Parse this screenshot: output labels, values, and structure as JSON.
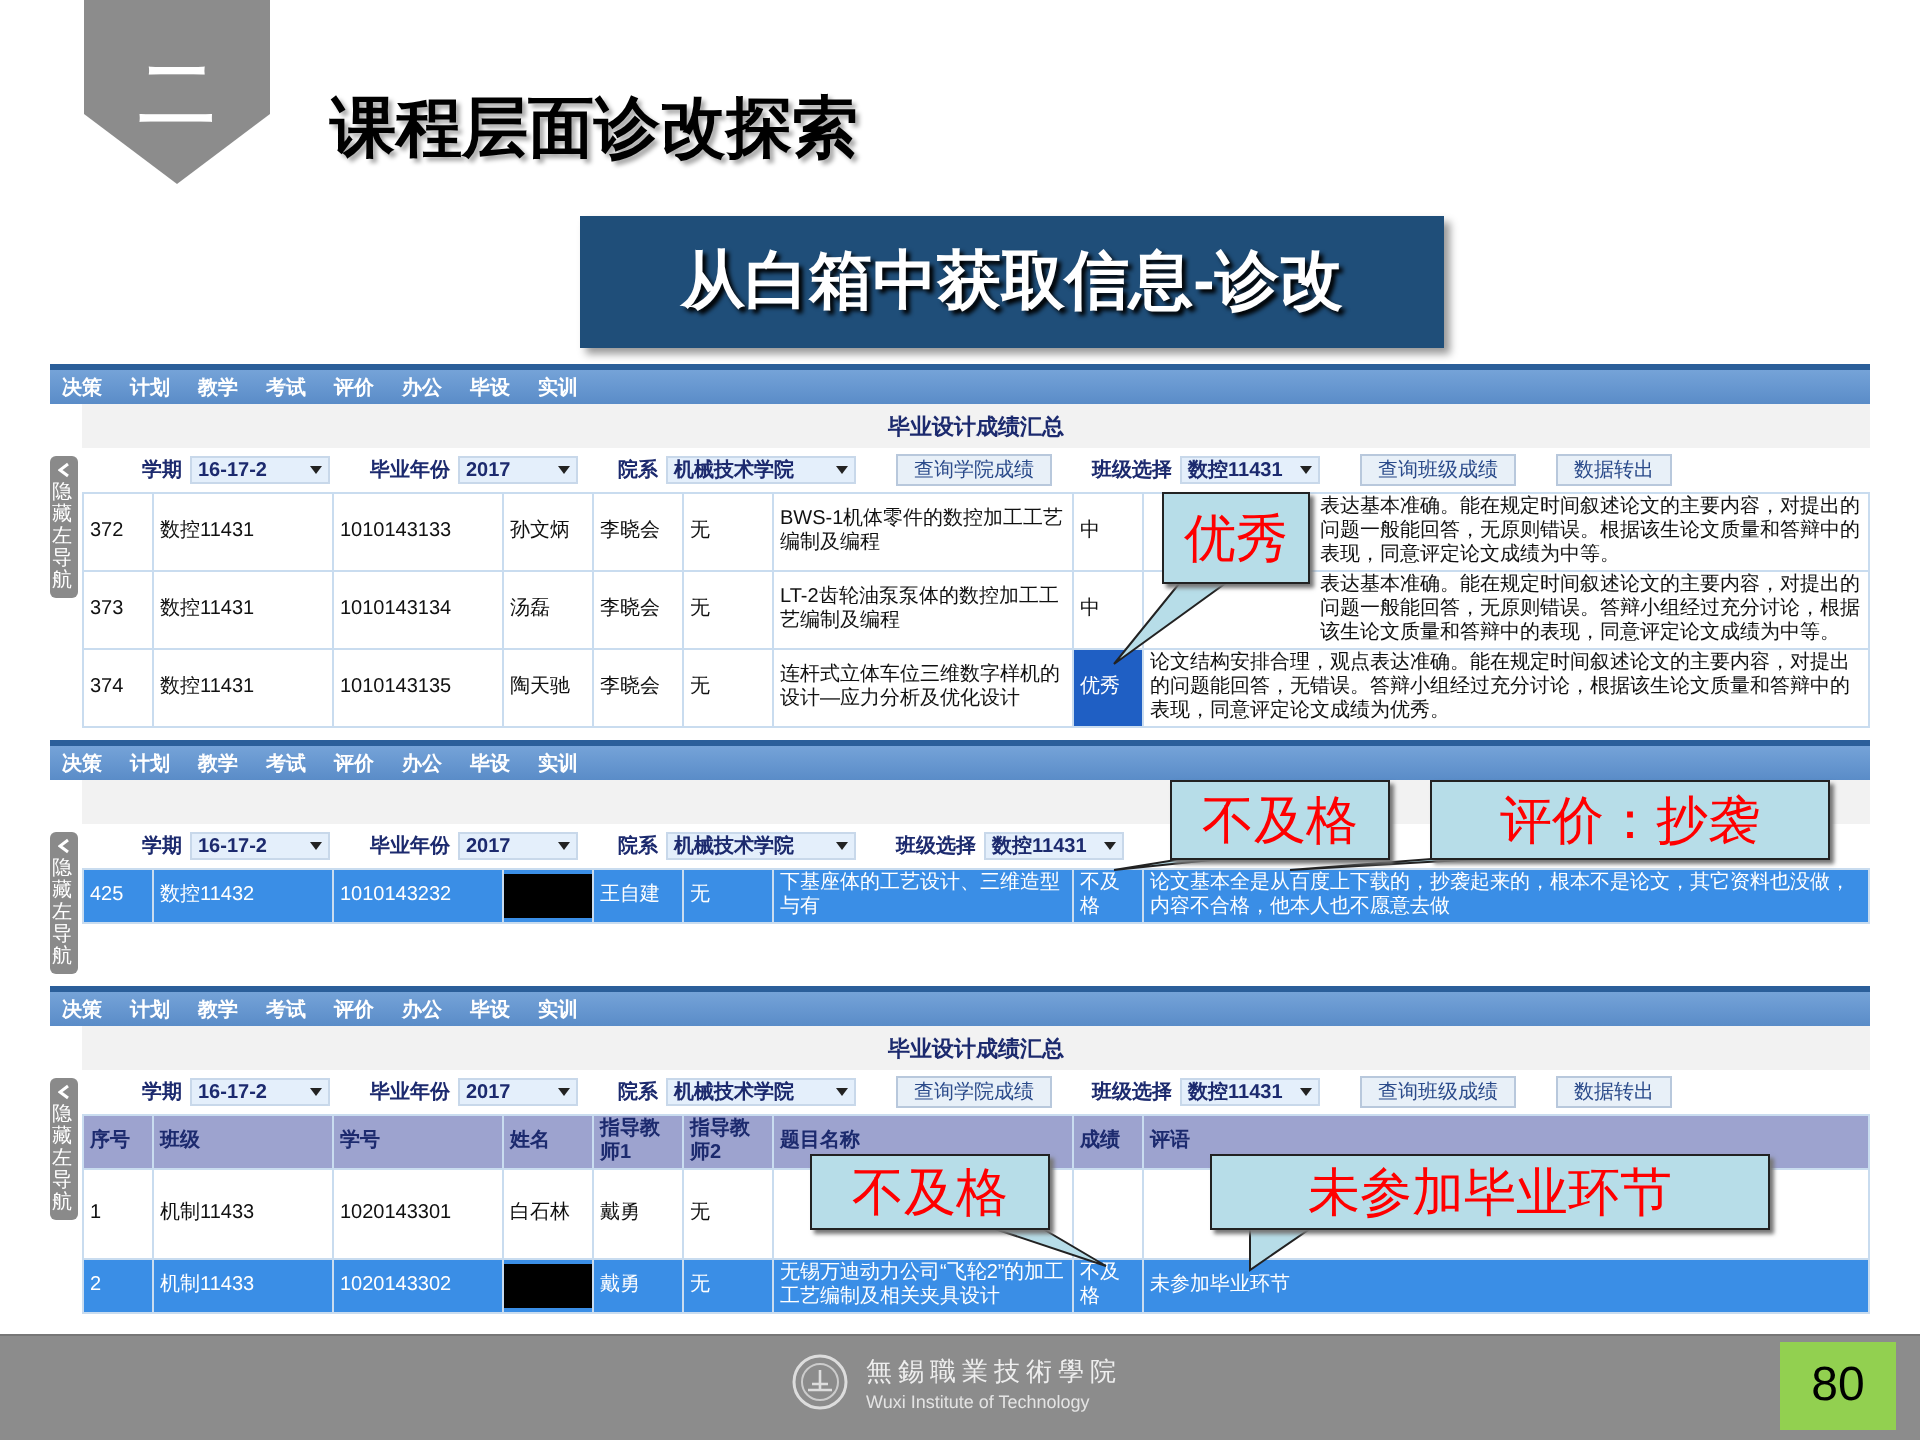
{
  "header": {
    "section_number": "二",
    "title": "课程层面诊改探索",
    "banner": "从白箱中获取信息-诊改"
  },
  "panels": [
    {
      "nav": [
        "决策",
        "计划",
        "教学",
        "考试",
        "评价",
        "办公",
        "毕设",
        "实训"
      ],
      "side_tab": "隐藏左导航",
      "title": "毕业设计成绩汇总",
      "controls": [
        {
          "kind": "select",
          "label": "学期",
          "value": "16-17-2"
        },
        {
          "kind": "select",
          "label": "毕业年份",
          "value": "2017"
        },
        {
          "kind": "select",
          "label": "院系",
          "value": "机械技术学院"
        },
        {
          "kind": "button",
          "label": "查询学院成绩"
        },
        {
          "kind": "select",
          "label": "班级选择",
          "value": "数控11431"
        },
        {
          "kind": "button",
          "label": "查询班级成绩"
        },
        {
          "kind": "button",
          "label": "数据转出"
        }
      ],
      "rows": [
        {
          "no": "372",
          "class": "数控11431",
          "student_id": "1010143133",
          "name": "孙文炳",
          "advisor_1": "李晓会",
          "advisor_2": "无",
          "topic": "BWS-1机体零件的数控加工工艺编制及编程",
          "grade": "中",
          "comment": "表达基本准确。能在规定时间叙述论文的主要内容，对提出的问题一般能回答，无原则错误。根据该生论文质量和答辩中的表现，同意评定论文成绩为中等。",
          "redacted": false,
          "selected": false,
          "grade_highlighted": false
        },
        {
          "no": "373",
          "class": "数控11431",
          "student_id": "1010143134",
          "name": "汤磊",
          "advisor_1": "李晓会",
          "advisor_2": "无",
          "topic": "LT-2齿轮油泵泵体的数控加工工艺编制及编程",
          "grade": "中",
          "comment": "表达基本准确。能在规定时间叙述论文的主要内容，对提出的问题一般能回答，无原则错误。答辩小组经过充分讨论，根据该生论文质量和答辩中的表现，同意评定论文成绩为中等。",
          "redacted": false,
          "selected": false,
          "grade_highlighted": false
        },
        {
          "no": "374",
          "class": "数控11431",
          "student_id": "1010143135",
          "name": "陶天驰",
          "advisor_1": "李晓会",
          "advisor_2": "无",
          "topic": "连杆式立体车位三维数字样机的设计—应力分析及优化设计",
          "grade": "优秀",
          "comment": "论文结构安排合理，观点表达准确。能在规定时间叙述论文的主要内容，对提出的问题能回答，无错误。答辩小组经过充分讨论，根据该生论文质量和答辩中的表现，同意评定论文成绩为优秀。",
          "redacted": false,
          "selected": false,
          "grade_highlighted": true
        }
      ],
      "callouts": [
        {
          "text": "优秀"
        }
      ]
    },
    {
      "nav": [
        "决策",
        "计划",
        "教学",
        "考试",
        "评价",
        "办公",
        "毕设",
        "实训"
      ],
      "side_tab": "隐藏左导航",
      "controls": [
        {
          "kind": "select",
          "label": "学期",
          "value": "16-17-2"
        },
        {
          "kind": "select",
          "label": "毕业年份",
          "value": "2017"
        },
        {
          "kind": "select",
          "label": "院系",
          "value": "机械技术学院"
        },
        {
          "kind": "select",
          "label": "班级选择",
          "value": "数控11431"
        }
      ],
      "rows": [
        {
          "no": "425",
          "class": "数控11432",
          "student_id": "1010143232",
          "advisor_1": "王自建",
          "advisor_2": "无",
          "topic": "下基座体的工艺设计、三维造型与有",
          "grade": "不及格",
          "comment": "论文基本全是从百度上下载的，抄袭起来的，根本不是论文，其它资料也没做，内容不合格，他本人也不愿意去做",
          "redacted": true,
          "selected": true,
          "grade_highlighted": false
        }
      ],
      "callouts": [
        {
          "text": "不及格"
        },
        {
          "text": "评价：抄袭"
        }
      ]
    },
    {
      "nav": [
        "决策",
        "计划",
        "教学",
        "考试",
        "评价",
        "办公",
        "毕设",
        "实训"
      ],
      "side_tab": "隐藏左导航",
      "title": "毕业设计成绩汇总",
      "controls": [
        {
          "kind": "select",
          "label": "学期",
          "value": "16-17-2"
        },
        {
          "kind": "select",
          "label": "毕业年份",
          "value": "2017"
        },
        {
          "kind": "select",
          "label": "院系",
          "value": "机械技术学院"
        },
        {
          "kind": "button",
          "label": "查询学院成绩"
        },
        {
          "kind": "select",
          "label": "班级选择",
          "value": "数控11431"
        },
        {
          "kind": "button",
          "label": "查询班级成绩"
        },
        {
          "kind": "button",
          "label": "数据转出"
        }
      ],
      "columns": [
        "序号",
        "班级",
        "学号",
        "姓名",
        "指导教师1",
        "指导教师2",
        "题目名称",
        "成绩",
        "评语"
      ],
      "rows": [
        {
          "no": "1",
          "class": "机制11433",
          "student_id": "1020143301",
          "name": "白石林",
          "advisor_1": "戴勇",
          "advisor_2": "无",
          "redacted": false,
          "selected": false,
          "grade_highlighted": false
        },
        {
          "no": "2",
          "class": "机制11433",
          "student_id": "1020143302",
          "advisor_1": "戴勇",
          "advisor_2": "无",
          "topic": "无锡万迪动力公司“飞轮2”的加工工艺编制及相关夹具设计",
          "grade": "不及格",
          "comment": "未参加毕业环节",
          "redacted": true,
          "selected": true,
          "grade_highlighted": false
        }
      ],
      "callouts": [
        {
          "text": "不及格"
        },
        {
          "text": "未参加毕业环节"
        }
      ]
    }
  ],
  "footer": {
    "school_name": "無錫職業技術學院",
    "school_name_en": "Wuxi Institute of Technology",
    "page_number": "80"
  }
}
